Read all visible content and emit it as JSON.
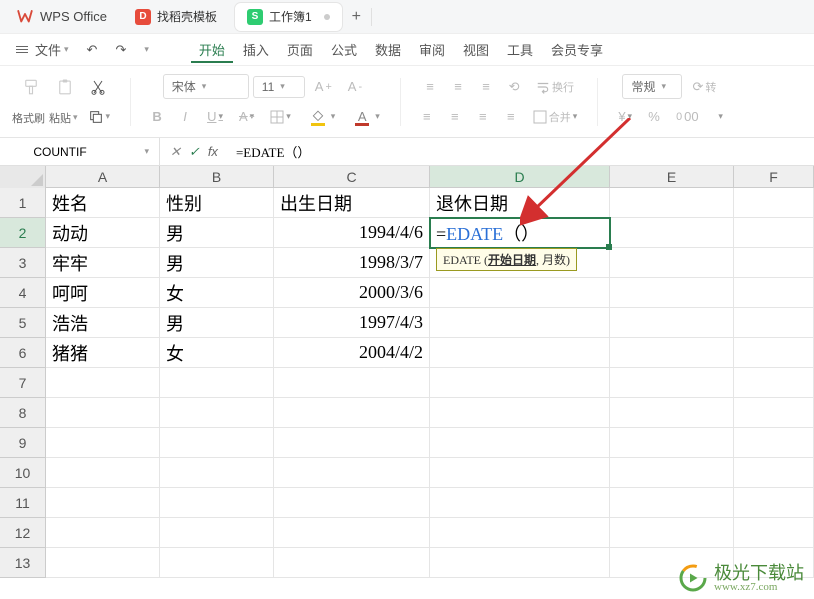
{
  "app": {
    "name": "WPS Office"
  },
  "tabs": [
    {
      "icon_color": "#e74c3c",
      "icon_letter": "D",
      "label": "找稻壳模板"
    },
    {
      "icon_color": "#2ecc71",
      "icon_letter": "S",
      "label": "工作簿1",
      "active": true
    }
  ],
  "menu": {
    "file": "文件",
    "items": [
      "开始",
      "插入",
      "页面",
      "公式",
      "数据",
      "审阅",
      "视图",
      "工具",
      "会员专享"
    ],
    "active": "开始"
  },
  "toolbar": {
    "format_painter": "格式刷",
    "paste": "粘贴",
    "font_name": "宋体",
    "font_size": "11",
    "wrap": "换行",
    "merge": "合并",
    "format": "常规",
    "rotate": "转"
  },
  "formula_bar": {
    "name_box": "COUNTIF",
    "fx": "fx",
    "value": "=EDATE（）"
  },
  "grid": {
    "cols": [
      "A",
      "B",
      "C",
      "D",
      "E",
      "F"
    ],
    "row_count": 13,
    "active_row": 2,
    "active_col": "D",
    "headers": {
      "A": "姓名",
      "B": "性别",
      "C": "出生日期",
      "D": "退休日期"
    },
    "rows": [
      {
        "A": "动动",
        "B": "男",
        "C": "1994/4/6",
        "D": "=EDATE（）"
      },
      {
        "A": "牢牢",
        "B": "男",
        "C": "1998/3/7"
      },
      {
        "A": "呵呵",
        "B": "女",
        "C": "2000/3/6"
      },
      {
        "A": "浩浩",
        "B": "男",
        "C": "1997/4/3"
      },
      {
        "A": "猪猪",
        "B": "女",
        "C": "2004/4/2"
      }
    ],
    "tooltip_prefix": "EDATE (",
    "tooltip_arg1": "开始日期",
    "tooltip_sep": ", ",
    "tooltip_arg2": "月数",
    "tooltip_suffix": ")"
  },
  "watermark": {
    "title": "极光下载站",
    "sub": "www.xz7.com"
  }
}
